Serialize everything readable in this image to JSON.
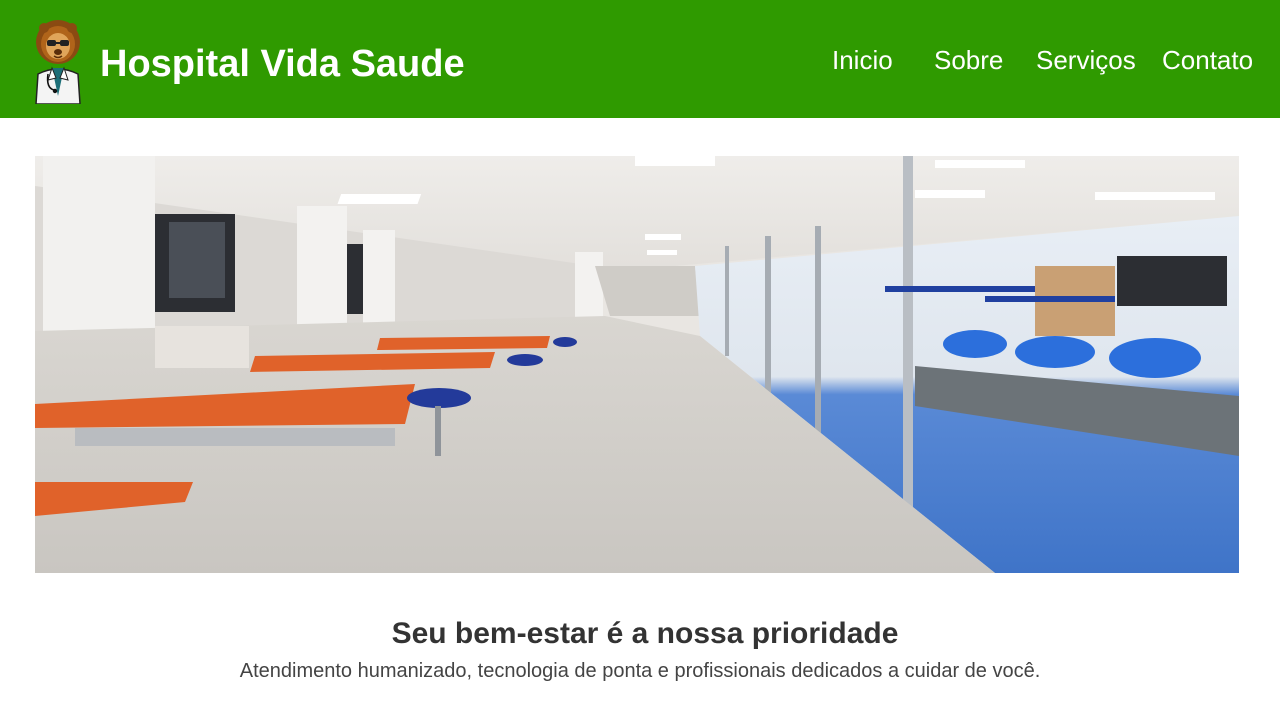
{
  "header": {
    "site_title": "Hospital Vida Saude",
    "logo_icon": "lion-doctor-logo",
    "background_color": "#2f9a00"
  },
  "nav": {
    "items": [
      {
        "label": "Inicio"
      },
      {
        "label": "Sobre"
      },
      {
        "label": "Serviços"
      },
      {
        "label": "Contato"
      }
    ]
  },
  "hero": {
    "image_icon": "hospital-physiotherapy-hallway-photo"
  },
  "intro": {
    "headline": "Seu bem-estar é a nossa prioridade",
    "subline": "Atendimento humanizado, tecnologia de ponta e profissionais dedicados a cuidar de você."
  }
}
